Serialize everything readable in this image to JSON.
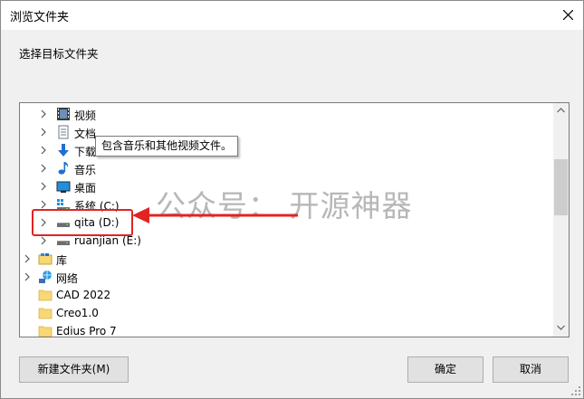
{
  "window": {
    "title": "浏览文件夹"
  },
  "dialog": {
    "prompt": "选择目标文件夹"
  },
  "tree": {
    "items": [
      {
        "label": "视频",
        "icon": "video-folder-icon"
      },
      {
        "label": "文档",
        "icon": "documents-folder-icon"
      },
      {
        "label": "下载",
        "icon": "download-folder-icon"
      },
      {
        "label": "音乐",
        "icon": "music-folder-icon"
      },
      {
        "label": "桌面",
        "icon": "desktop-folder-icon"
      },
      {
        "label": "系统 (C:)",
        "icon": "system-drive-icon"
      },
      {
        "label": "qita (D:)",
        "icon": "drive-icon"
      },
      {
        "label": "ruanjian (E:)",
        "icon": "drive-icon"
      },
      {
        "label": "库",
        "icon": "library-icon"
      },
      {
        "label": "网络",
        "icon": "network-icon"
      },
      {
        "label": "CAD 2022",
        "icon": "folder-icon"
      },
      {
        "label": "Creo1.0",
        "icon": "folder-icon"
      },
      {
        "label": "Edius Pro 7",
        "icon": "folder-icon"
      }
    ],
    "tooltip": "包含音乐和其他视频文件。"
  },
  "watermark": "公众号：  开源神器",
  "buttons": {
    "new_folder": "新建文件夹(M)",
    "ok": "确定",
    "cancel": "取消"
  },
  "colors": {
    "annotation_red": "#e32222",
    "folder_yellow": "#f8d775"
  }
}
